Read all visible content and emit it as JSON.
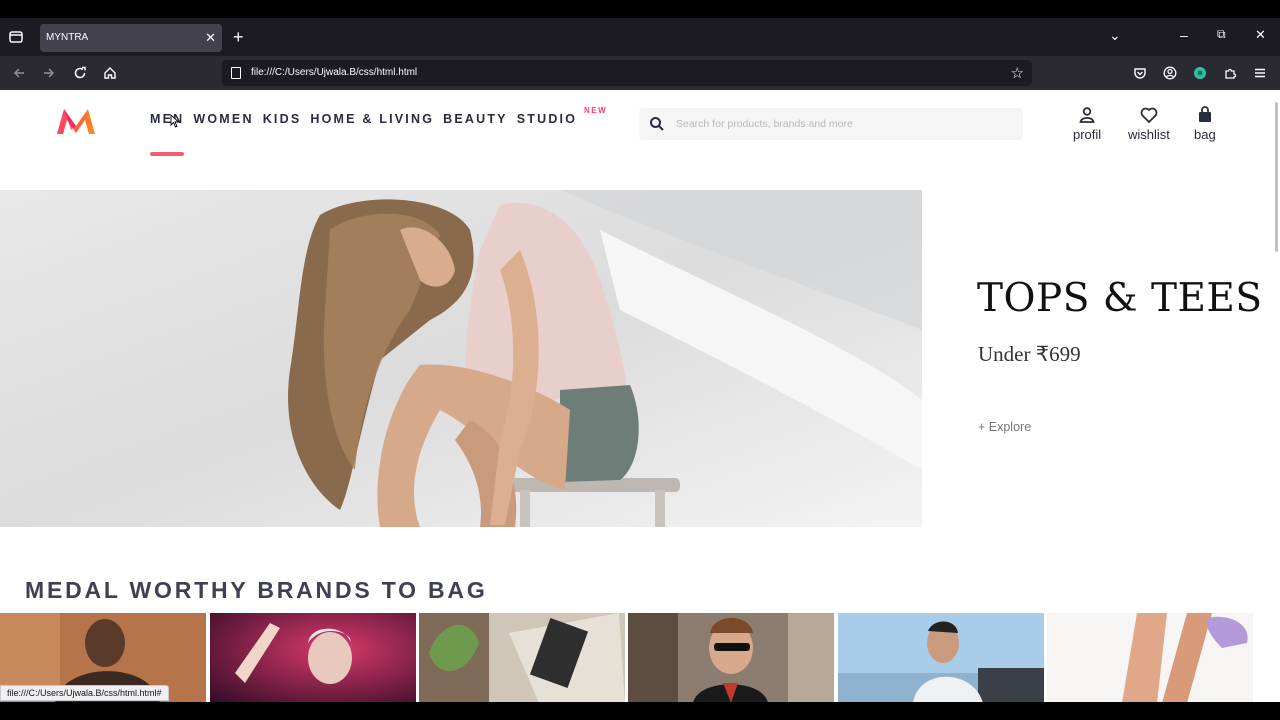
{
  "browser": {
    "tab_title": "MYNTRA",
    "tab_close": "✕",
    "new_tab": "+",
    "url": "file:///C:/Users/Ujwala.B/css/html.html",
    "status_url": "file:///C:/Users/Ujwala.B/css/html.html#",
    "min": "–",
    "restore": "⧉",
    "close": "✕",
    "list_tabs": "⌄"
  },
  "site": {
    "nav": [
      {
        "label": "MEN"
      },
      {
        "label": "WOMEN"
      },
      {
        "label": "KIDS"
      },
      {
        "label": "HOME & LIVING"
      },
      {
        "label": "BEAUTY"
      },
      {
        "label": "STUDIO",
        "sup": "NEW"
      }
    ],
    "search": {
      "placeholder": "Search for products, brands and more"
    },
    "actions": {
      "profile": "profil",
      "wishlist": "wishlist",
      "bag": "bag"
    },
    "accent_color": "#ff3f6c"
  },
  "hero": {
    "title": "TOPS & TEES",
    "subtitle": "Under ₹699",
    "link": "+ Explore"
  },
  "brands": {
    "title": "MEDAL WORTHY BRANDS TO BAG"
  }
}
